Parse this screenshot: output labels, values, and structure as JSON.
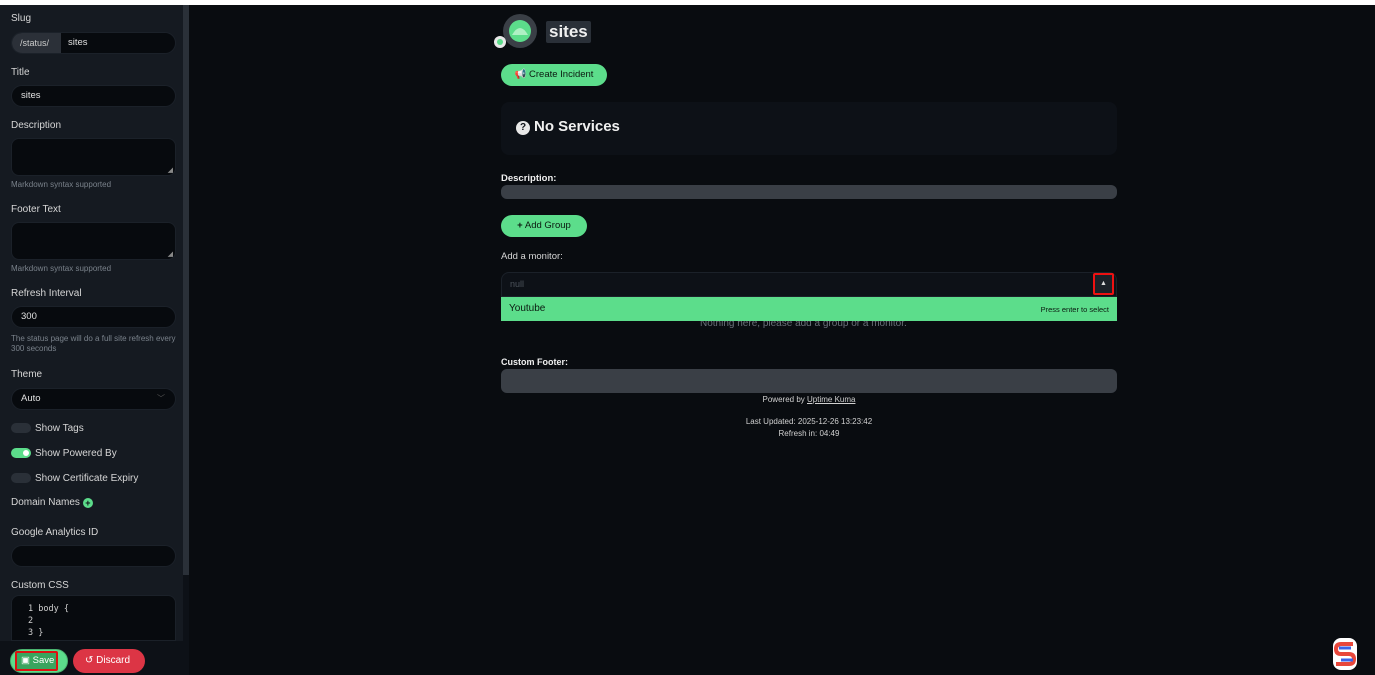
{
  "sidebar": {
    "slug": {
      "label": "Slug",
      "prefix": "/status/",
      "value": "sites"
    },
    "title": {
      "label": "Title",
      "value": "sites"
    },
    "description": {
      "label": "Description",
      "hint": "Markdown syntax supported"
    },
    "footer_text": {
      "label": "Footer Text",
      "hint": "Markdown syntax supported"
    },
    "refresh": {
      "label": "Refresh Interval",
      "value": "300",
      "hint": "The status page will do a full site refresh every 300 seconds"
    },
    "theme": {
      "label": "Theme",
      "value": "Auto"
    },
    "toggles": [
      {
        "label": "Show Tags",
        "on": false
      },
      {
        "label": "Show Powered By",
        "on": true
      },
      {
        "label": "Show Certificate Expiry",
        "on": false
      }
    ],
    "domain_names_label": "Domain Names",
    "analytics_label": "Google Analytics ID",
    "custom_css": {
      "label": "Custom CSS",
      "lines": [
        "1  body {",
        "2",
        "3  }"
      ]
    },
    "save_label": "Save",
    "discard_label": "Discard"
  },
  "main": {
    "title": "sites",
    "create_incident_label": "Create Incident",
    "no_services": "No Services",
    "description_label": "Description:",
    "add_group_label": "Add Group",
    "add_monitor_label": "Add a monitor:",
    "monitor_placeholder": "null",
    "option": {
      "label": "Youtube",
      "hint": "Press enter to select"
    },
    "hidden_message": "Nothing here, please add a group or a monitor.",
    "custom_footer_label": "Custom Footer:",
    "powered_by": "Powered by",
    "powered_link": "Uptime Kuma",
    "last_updated": "Last Updated: 2025-12-26 13:23:42",
    "refresh_in": "Refresh in: 04:49"
  },
  "colors": {
    "accent": "#5cdd8b",
    "danger": "#dc3545",
    "background": "#090c10",
    "highlight": "#e11111"
  }
}
